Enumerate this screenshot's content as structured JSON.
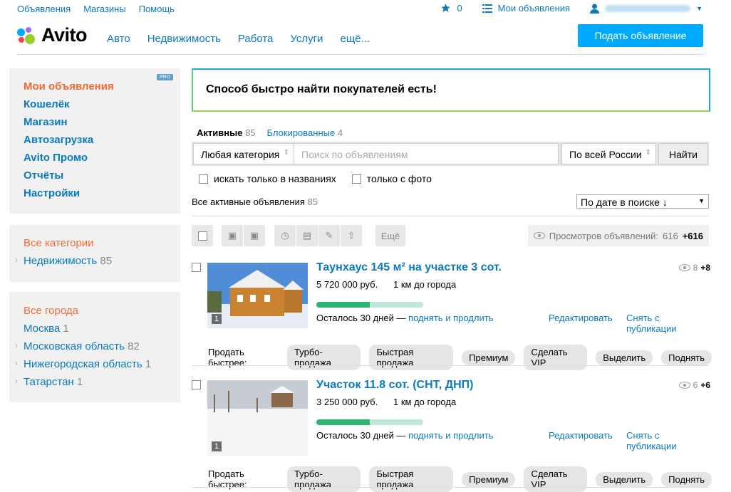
{
  "topbar": {
    "links": [
      "Объявления",
      "Магазины",
      "Помощь"
    ],
    "favorites_count": "0",
    "my_ads": "Мои объявления"
  },
  "header": {
    "logo": "Avito",
    "nav": [
      "Авто",
      "Недвижимость",
      "Работа",
      "Услуги",
      "ещё..."
    ],
    "post_button": "Подать объявление"
  },
  "sidebar": {
    "menu": [
      {
        "label": "Мои объявления",
        "active": true
      },
      {
        "label": "Кошелёк"
      },
      {
        "label": "Магазин"
      },
      {
        "label": "Автозагрузка"
      },
      {
        "label": "Avito Промо"
      },
      {
        "label": "Отчёты"
      },
      {
        "label": "Настройки"
      }
    ],
    "pro_badge": "PRO",
    "categories_title": "Все категории",
    "categories": [
      {
        "label": "Недвижимость",
        "count": "85"
      }
    ],
    "cities_title": "Все города",
    "cities": [
      {
        "label": "Москва",
        "count": "1"
      },
      {
        "label": "Московская область",
        "count": "82"
      },
      {
        "label": "Нижегородская область",
        "count": "1"
      },
      {
        "label": "Татарстан",
        "count": "1"
      }
    ]
  },
  "banner": "Способ быстро найти покупателей есть!",
  "tabs": {
    "active_label": "Активные",
    "active_count": "85",
    "blocked_label": "Блокированные",
    "blocked_count": "4"
  },
  "search": {
    "category": "Любая категория",
    "placeholder": "Поиск по объявлениям",
    "region": "По всей России",
    "button": "Найти"
  },
  "options": {
    "titles_only": "искать только в названиях",
    "with_photo": "только с фото"
  },
  "list_header": {
    "label": "Все активные объявления",
    "count": "85",
    "sort": "По дате в поиске ↓"
  },
  "toolbar": {
    "more": "Ещё",
    "views_label": "Просмотров объявлений:",
    "views_count": "616",
    "views_delta": "+616"
  },
  "listings": [
    {
      "title": "Таунхаус 145 м² на участке 3 сот.",
      "price": "5 720 000 руб.",
      "distance": "1 км до города",
      "remaining": "Осталось 30 дней —",
      "extend": "поднять и продлить",
      "edit": "Редактировать",
      "unpublish": "Снять с публикации",
      "views": "8",
      "views_delta": "+8",
      "photo_count": "1",
      "progress": 0.5
    },
    {
      "title": "Участок 11.8 сот. (СНТ, ДНП)",
      "price": "3 250 000 руб.",
      "distance": "1 км до города",
      "remaining": "Осталось 30 дней —",
      "extend": "поднять и продлить",
      "edit": "Редактировать",
      "unpublish": "Снять с публикации",
      "views": "6",
      "views_delta": "+6",
      "photo_count": "1",
      "progress": 0.5
    }
  ],
  "sell_faster": {
    "label": "Продать быстрее:",
    "options": [
      "Турбо-продажа",
      "Быстрая продажа",
      "Премиум",
      "Сделать VIP",
      "Выделить",
      "Поднять"
    ]
  },
  "colors": {
    "accent": "#00aaff",
    "link": "#0a7abf",
    "orange": "#f26b38",
    "progress": "#2bb673"
  }
}
